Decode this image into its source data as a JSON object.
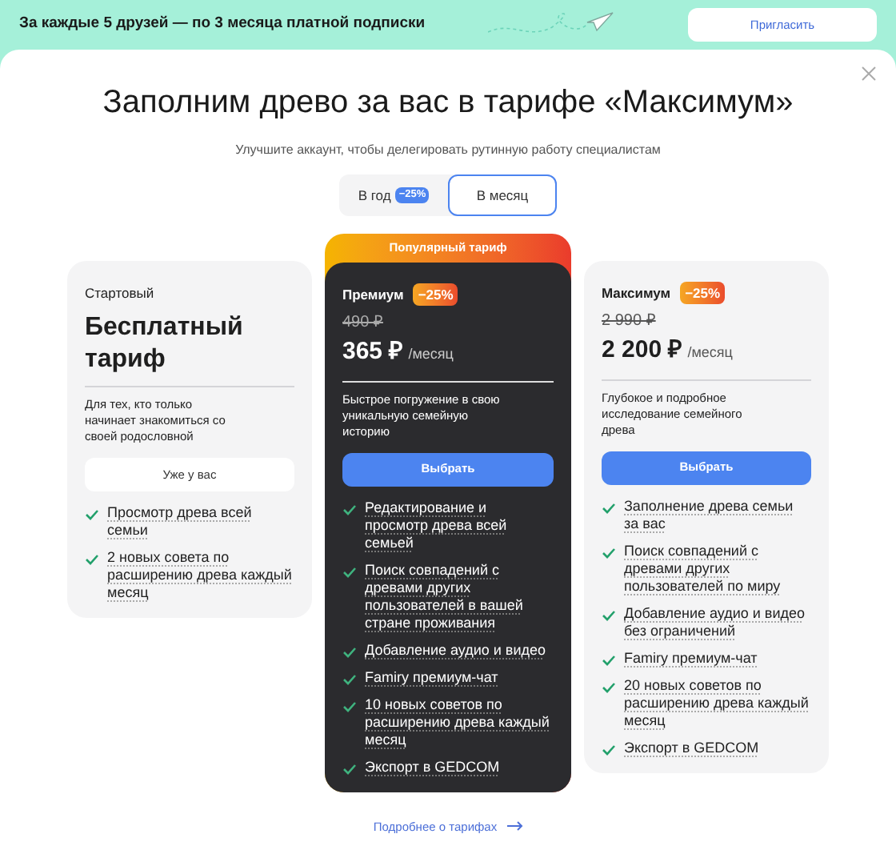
{
  "banner": {
    "text": "За каждые 5 друзей — по 3 месяца платной подписки",
    "button": "Пригласить"
  },
  "modal": {
    "title": "Заполним древо за вас в тарифе «Максимум»",
    "subtitle": "Улучшите аккаунт, чтобы делегировать рутинную работу специалистам"
  },
  "billing": [
    {
      "label": "В год",
      "badge": "−25%",
      "selected": false
    },
    {
      "label": "В месяц",
      "selected": true
    }
  ],
  "plans": [
    {
      "kind": "free",
      "tier": "Стартовый",
      "name": "Бесплатный тариф",
      "description": "Для тех, кто только начинает знакомиться со своей родословной",
      "button": "Уже у вас",
      "features": [
        "Просмотр древа всей семьи",
        "2 новых совета по расширению древа каждый месяц"
      ]
    },
    {
      "kind": "popular",
      "ribbon": "Популярный тариф",
      "tier": "Премиум",
      "discount": "−25%",
      "old_price": "490 ₽",
      "price": "365 ₽",
      "period": "/месяц",
      "description": "Быстрое погружение в свою уникальную семейную историю",
      "button": "Выбрать",
      "features": [
        "Редактирование и просмотр древа всей семьей",
        "Поиск совпадений с древами других пользователей в вашей стране проживания",
        "Добавление аудио и видео",
        "Famiry премиум-чат",
        "10 новых советов по расширению древа каждый месяц",
        "Экспорт в GEDCOM"
      ]
    },
    {
      "kind": "paid",
      "tier": "Максимум",
      "discount": "−25%",
      "old_price": "2 990 ₽",
      "price": "2 200 ₽",
      "period": "/месяц",
      "description": "Глубокое и подробное исследование семейного древа",
      "button": "Выбрать",
      "features": [
        "Заполнение древа семьи за вас",
        "Поиск совпадений с древами других пользователей по миру",
        "Добавление аудио и видео без ограничений",
        "Famiry премиум-чат",
        "20 новых советов по расширению древа каждый месяц",
        "Экспорт в GEDCOM"
      ]
    }
  ],
  "more_link": "Подробнее о тарифах"
}
